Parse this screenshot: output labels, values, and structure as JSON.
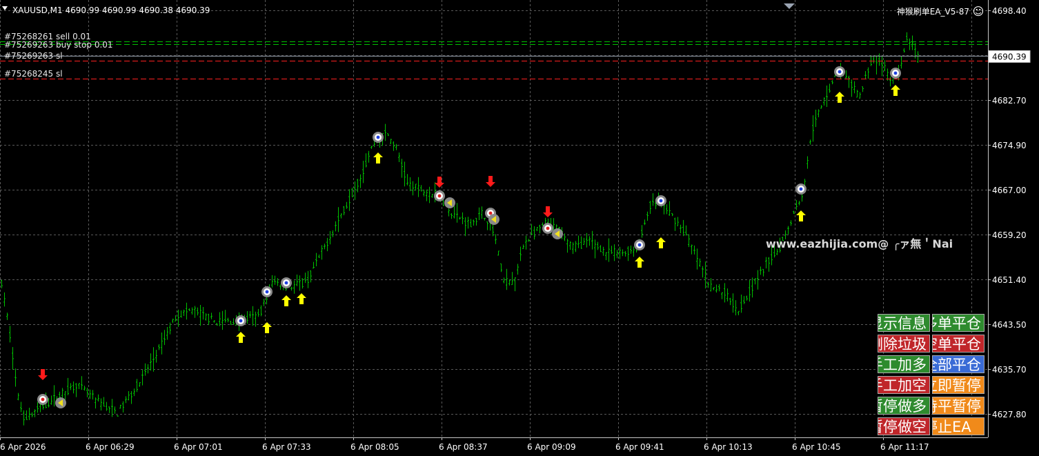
{
  "header": {
    "symbol_info": "XAUUSD,M1  4690.99 4690.99 4690.38 4690.39",
    "ea_name": "神猴刷单EA_V5-87",
    "smiley": "☺",
    "watermark": "www.eazhijia.com@ ╭ァ無＇Nai"
  },
  "price_axis": {
    "labels": [
      "4698.40",
      "4690.39",
      "4682.70",
      "4674.90",
      "4667.00",
      "4659.20",
      "4651.40",
      "4643.50",
      "4635.70",
      "4627.80"
    ],
    "current_price": "4690.39",
    "current_value": 4690.39
  },
  "time_axis": {
    "labels": [
      "6 Apr 2026",
      "6 Apr 06:29",
      "6 Apr 07:01",
      "6 Apr 07:33",
      "6 Apr 08:05",
      "6 Apr 08:37",
      "6 Apr 09:09",
      "6 Apr 09:41",
      "6 Apr 10:13",
      "6 Apr 10:45",
      "6 Apr 11:17"
    ]
  },
  "order_lines": [
    {
      "label": "#75268261 sell 0.01",
      "color": "#00c000"
    },
    {
      "label": "#75269263 buy stop 0.01",
      "color": "#00c000"
    },
    {
      "label": "#75269263 sl",
      "color": "#ff2020"
    },
    {
      "label": "#75268245 sl",
      "color": "#ff2020"
    }
  ],
  "buttons": {
    "left": [
      {
        "label": "显示信息",
        "color": "#2e8b2e"
      },
      {
        "label": "删除垃圾",
        "color": "#c0262a"
      },
      {
        "label": "手工加多",
        "color": "#2e8b2e"
      },
      {
        "label": "手工加空",
        "color": "#c0262a"
      },
      {
        "label": "暂停做多",
        "color": "#2e8b2e"
      },
      {
        "label": "暂停做空",
        "color": "#c0262a"
      }
    ],
    "right": [
      {
        "label": "多单平仓",
        "color": "#2e8b2e"
      },
      {
        "label": "空单平仓",
        "color": "#c0262a"
      },
      {
        "label": "全部平仓",
        "color": "#3a6bd6"
      },
      {
        "label": "立即暂停",
        "color": "#f08a1a"
      },
      {
        "label": "持平暂停",
        "color": "#f08a1a"
      },
      {
        "label": "停止EA",
        "color": "#f08a1a"
      }
    ]
  },
  "colors": {
    "background": "#000000",
    "candles": "#00c000",
    "grid": "#5a5a5a",
    "axis_text": "#ffffff",
    "buy_arrow": "#ffff00",
    "sell_arrow": "#ff1a1a"
  }
}
